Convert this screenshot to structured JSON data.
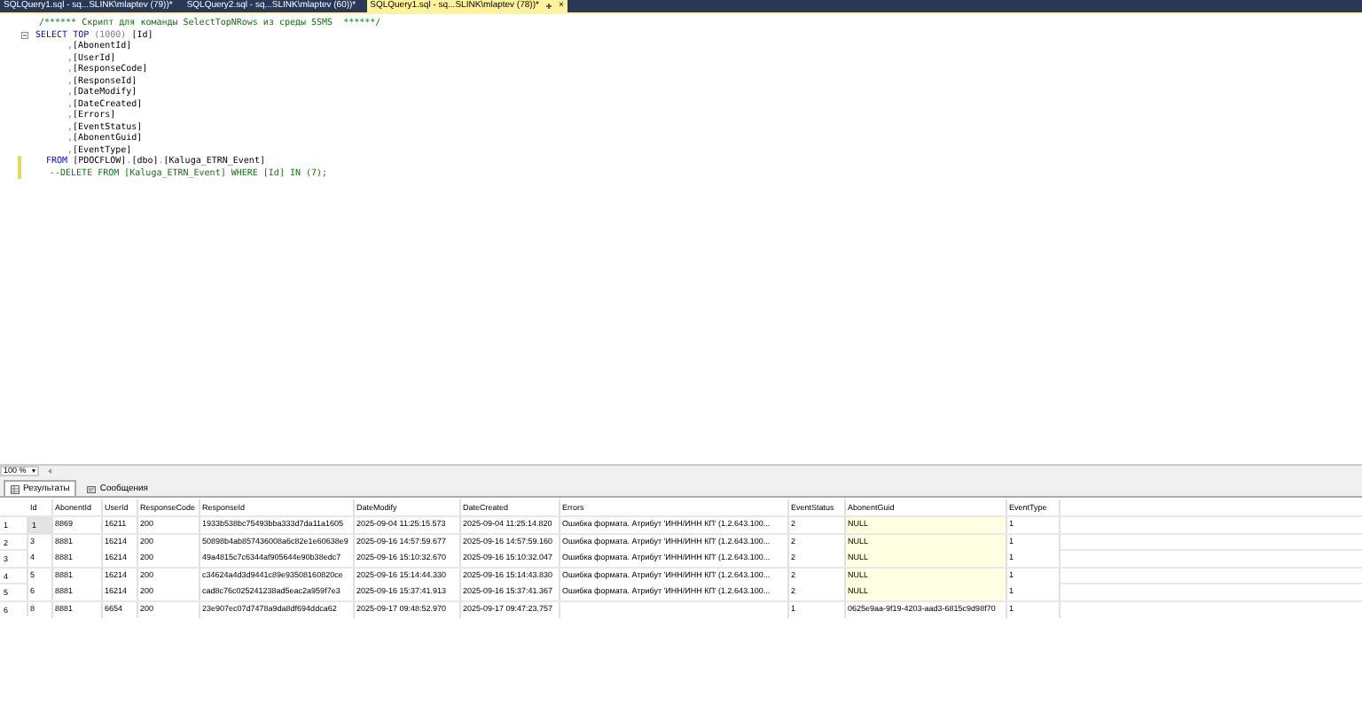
{
  "tabs": [
    {
      "label": "SQLQuery1.sql - sq...SLINK\\mlaptev (79))*",
      "selected": false
    },
    {
      "label": "SQLQuery2.sql - sq...SLINK\\mlaptev (60))*",
      "selected": false
    },
    {
      "label": "SQLQuery1.sql - sq...SLINK\\mlaptev (78))*",
      "selected": true,
      "close": "×"
    }
  ],
  "editor": {
    "lines": [
      {
        "kind": "comment",
        "changed": false,
        "tokens": [
          {
            "kind": "comment",
            "text": "/****** Скрипт для команды SelectTopNRows из среды SSMS  ******/"
          }
        ]
      },
      {
        "kind": "select",
        "changed": false,
        "tokens": [
          {
            "kind": "keyword",
            "text": "SELECT TOP"
          },
          {
            "kind": "punct",
            "text": " (1000) "
          },
          {
            "kind": "ident",
            "text": "[Id]"
          }
        ]
      },
      {
        "kind": "column",
        "changed": false,
        "tokens": [
          {
            "kind": "punct",
            "text": ","
          },
          {
            "kind": "ident",
            "text": "[AbonentId]"
          }
        ]
      },
      {
        "kind": "column",
        "changed": false,
        "tokens": [
          {
            "kind": "punct",
            "text": ","
          },
          {
            "kind": "ident",
            "text": "[UserId]"
          }
        ]
      },
      {
        "kind": "column",
        "changed": false,
        "tokens": [
          {
            "kind": "punct",
            "text": ","
          },
          {
            "kind": "ident",
            "text": "[ResponseCode]"
          }
        ]
      },
      {
        "kind": "column",
        "changed": false,
        "tokens": [
          {
            "kind": "punct",
            "text": ","
          },
          {
            "kind": "ident",
            "text": "[ResponseId]"
          }
        ]
      },
      {
        "kind": "column",
        "changed": false,
        "tokens": [
          {
            "kind": "punct",
            "text": ","
          },
          {
            "kind": "ident",
            "text": "[DateModify]"
          }
        ]
      },
      {
        "kind": "column",
        "changed": false,
        "tokens": [
          {
            "kind": "punct",
            "text": ","
          },
          {
            "kind": "ident",
            "text": "[DateCreated]"
          }
        ]
      },
      {
        "kind": "column",
        "changed": false,
        "tokens": [
          {
            "kind": "punct",
            "text": ","
          },
          {
            "kind": "ident",
            "text": "[Errors]"
          }
        ]
      },
      {
        "kind": "column",
        "changed": false,
        "tokens": [
          {
            "kind": "punct",
            "text": ","
          },
          {
            "kind": "ident",
            "text": "[EventStatus]"
          }
        ]
      },
      {
        "kind": "column",
        "changed": false,
        "tokens": [
          {
            "kind": "punct",
            "text": ","
          },
          {
            "kind": "ident",
            "text": "[AbonentGuid]"
          }
        ]
      },
      {
        "kind": "column",
        "changed": false,
        "tokens": [
          {
            "kind": "punct",
            "text": ","
          },
          {
            "kind": "ident",
            "text": "[EventType]"
          }
        ]
      },
      {
        "kind": "from",
        "changed": true,
        "tokens": [
          {
            "kind": "keyword",
            "text": "FROM "
          },
          {
            "kind": "ident",
            "text": "[PDOCFLOW]"
          },
          {
            "kind": "punct",
            "text": "."
          },
          {
            "kind": "ident",
            "text": "[dbo]"
          },
          {
            "kind": "punct",
            "text": "."
          },
          {
            "kind": "ident",
            "text": "[Kaluga_ETRN_Event]"
          }
        ]
      },
      {
        "kind": "delete",
        "changed": true,
        "tokens": [
          {
            "kind": "comment",
            "text": "--DELETE FROM [Kaluga_ETRN_Event] WHERE [Id] IN (7);"
          }
        ]
      }
    ]
  },
  "zoom": {
    "value": "100 %"
  },
  "result_tabs": [
    {
      "label": "Результаты",
      "selected": true,
      "kind": "grid"
    },
    {
      "label": "Сообщения",
      "selected": false,
      "kind": "messages"
    }
  ],
  "table": {
    "columns": [
      "Id",
      "AbonentId",
      "UserId",
      "ResponseCode",
      "ResponseId",
      "DateModify",
      "DateCreated",
      "Errors",
      "EventStatus",
      "AbonentGuid",
      "EventType"
    ],
    "rows": [
      {
        "number": "1",
        "selected": true,
        "null_guid": true,
        "cells": [
          "1",
          "8869",
          "16211",
          "200",
          "1933b538bc75493bba333d7da11a1605",
          "2025-09-04 11:25:15.573",
          "2025-09-04 11:25:14.820",
          "Ошибка формата. Атрибут 'ИНН/ИНН КП' (1.2.643.100...",
          "2",
          "NULL",
          "1"
        ]
      },
      {
        "number": "2",
        "selected": false,
        "null_guid": true,
        "cells": [
          "3",
          "8881",
          "16214",
          "200",
          "50898b4ab857436008a6c82e1e60638e9",
          "2025-09-16 14:57:59.677",
          "2025-09-16 14:57:59.160",
          "Ошибка формата. Атрибут 'ИНН/ИНН КП' (1.2.643.100...",
          "2",
          "NULL",
          "1"
        ]
      },
      {
        "number": "3",
        "selected": false,
        "null_guid": true,
        "cells": [
          "4",
          "8881",
          "16214",
          "200",
          "49a4815c7c6344af905644e90b38edc7",
          "2025-09-16 15:10:32.670",
          "2025-09-16 15:10:32.047",
          "Ошибка формата. Атрибут 'ИНН/ИНН КП' (1.2.643.100...",
          "2",
          "NULL",
          "1"
        ]
      },
      {
        "number": "4",
        "selected": false,
        "null_guid": true,
        "cells": [
          "5",
          "8881",
          "16214",
          "200",
          "c34624a4d3d9441c89e93508160820ce",
          "2025-09-16 15:14:44.330",
          "2025-09-16 15:14:43.830",
          "Ошибка формата. Атрибут 'ИНН/ИНН КП' (1.2.643.100...",
          "2",
          "NULL",
          "1"
        ]
      },
      {
        "number": "5",
        "selected": false,
        "null_guid": true,
        "cells": [
          "6",
          "8881",
          "16214",
          "200",
          "cad8c76c025241238ad5eac2a959f7e3",
          "2025-09-16 15:37:41.913",
          "2025-09-16 15:37:41.367",
          "Ошибка формата. Атрибут 'ИНН/ИНН КП' (1.2.643.100...",
          "2",
          "NULL",
          "1"
        ]
      },
      {
        "number": "6",
        "selected": false,
        "null_guid": false,
        "cells": [
          "8",
          "8881",
          "6654",
          "200",
          "23e907ec07d7478a9da8df694ddca62",
          "2025-09-17 09:48:52.970",
          "2025-09-17 09:47:23.757",
          null,
          "1",
          "0625e9aa-9f19-4203-aad3-6815c9d98f70",
          "1"
        ]
      }
    ]
  }
}
